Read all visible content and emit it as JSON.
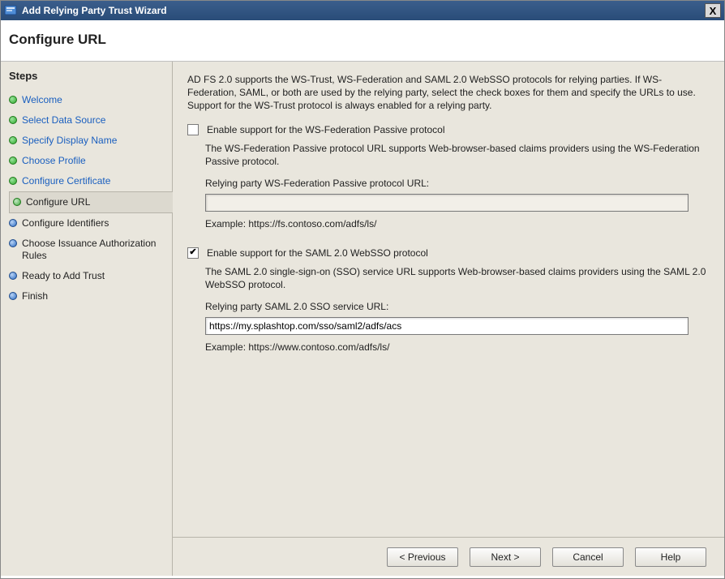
{
  "window": {
    "title": "Add Relying Party Trust Wizard",
    "close_label": "X"
  },
  "header": {
    "title": "Configure URL"
  },
  "sidebar": {
    "title": "Steps",
    "steps": [
      {
        "label": "Welcome",
        "state": "done"
      },
      {
        "label": "Select Data Source",
        "state": "done"
      },
      {
        "label": "Specify Display Name",
        "state": "done"
      },
      {
        "label": "Choose Profile",
        "state": "done"
      },
      {
        "label": "Configure Certificate",
        "state": "done"
      },
      {
        "label": "Configure URL",
        "state": "current"
      },
      {
        "label": "Configure Identifiers",
        "state": "todo"
      },
      {
        "label": "Choose Issuance Authorization Rules",
        "state": "todo"
      },
      {
        "label": "Ready to Add Trust",
        "state": "todo"
      },
      {
        "label": "Finish",
        "state": "todo"
      }
    ]
  },
  "main": {
    "intro": "AD FS 2.0 supports the WS-Trust, WS-Federation and SAML 2.0 WebSSO protocols for relying parties.  If WS-Federation, SAML, or both are used by the relying party, select the check boxes for them and specify the URLs to use.  Support for the WS-Trust protocol is always enabled for a relying party.",
    "wsfed": {
      "checkbox_label": "Enable support for the WS-Federation Passive protocol",
      "checked": false,
      "description": "The WS-Federation Passive protocol URL supports Web-browser-based claims providers using the WS-Federation Passive protocol.",
      "field_label": "Relying party WS-Federation Passive protocol URL:",
      "value": "",
      "example": "Example: https://fs.contoso.com/adfs/ls/"
    },
    "saml": {
      "checkbox_label": "Enable support for the SAML 2.0 WebSSO protocol",
      "checked": true,
      "description": "The SAML 2.0 single-sign-on (SSO) service URL supports Web-browser-based claims providers using the SAML 2.0 WebSSO protocol.",
      "field_label": "Relying party SAML 2.0 SSO service URL:",
      "value": "https://my.splashtop.com/sso/saml2/adfs/acs",
      "example": "Example: https://www.contoso.com/adfs/ls/"
    }
  },
  "footer": {
    "previous": "< Previous",
    "next": "Next >",
    "cancel": "Cancel",
    "help": "Help"
  }
}
